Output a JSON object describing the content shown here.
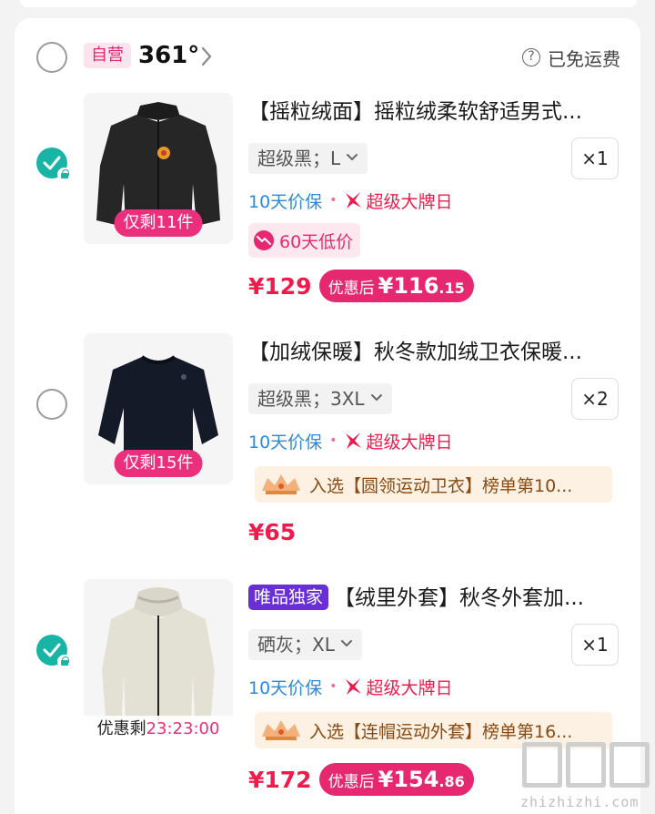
{
  "store": {
    "self_tag": "自营",
    "name": "361°",
    "shipping": "已免运费"
  },
  "items": [
    {
      "selected": true,
      "title": "【摇粒绒面】摇粒绒柔软舒适男式...",
      "stock_label": "仅剩11件",
      "sku": "超级黑；L",
      "qty": "×1",
      "svc_guarantee": "10天价保",
      "svc_event": "超级大牌日",
      "promo_badge": "60天低价",
      "price": "¥129",
      "after_label": "优惠后",
      "after_price": "¥116",
      "after_cents": ".15"
    },
    {
      "selected": false,
      "title": "【加绒保暖】秋冬款加绒卫衣保暖...",
      "stock_label": "仅剩15件",
      "sku": "超级黑；3XL",
      "qty": "×2",
      "svc_guarantee": "10天价保",
      "svc_event": "超级大牌日",
      "rank_text": "入选【圆领运动卫衣】榜单第10...",
      "price": "¥65"
    },
    {
      "selected": true,
      "exclusive_tag": "唯品独家",
      "title": "【绒里外套】秋冬外套加...",
      "countdown_label": "优惠剩",
      "countdown_time": "23:23:00",
      "sku": "硒灰；XL",
      "qty": "×1",
      "svc_guarantee": "10天价保",
      "svc_event": "超级大牌日",
      "rank_text": "入选【连帽运动外套】榜单第16...",
      "price": "¥172",
      "after_label": "优惠后",
      "after_price": "¥154",
      "after_cents": ".86"
    }
  ],
  "watermark": {
    "domain": "zhizhizhi.com"
  }
}
